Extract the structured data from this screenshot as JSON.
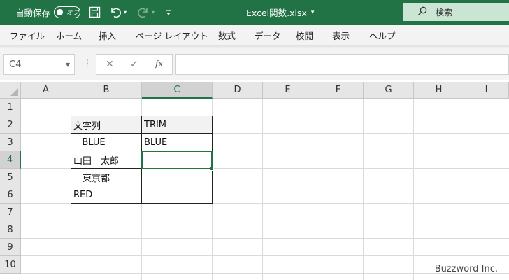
{
  "titlebar": {
    "autosave_label": "自動保存",
    "autosave_state": "オフ",
    "save_icon": "save-icon",
    "undo_icon": "undo-icon",
    "redo_icon": "redo-icon",
    "customize_icon": "customize-qat-icon",
    "file_title": "Excel関数.xlsx",
    "file_title_dropdown": "▾",
    "search_placeholder": "検索"
  },
  "ribbon": {
    "tabs": [
      "ファイル",
      "ホーム",
      "挿入",
      "ページ レイアウト",
      "数式",
      "データ",
      "校閲",
      "表示",
      "ヘルプ"
    ]
  },
  "formula_bar": {
    "name_box": "C4",
    "cancel_glyph": "✕",
    "enter_glyph": "✓",
    "fx_glyph": "fx",
    "formula": ""
  },
  "sheet": {
    "columns": [
      "A",
      "B",
      "C",
      "D",
      "E",
      "F",
      "G",
      "H",
      "I"
    ],
    "rows": [
      "1",
      "2",
      "3",
      "4",
      "5",
      "6",
      "7",
      "8",
      "9",
      "10"
    ],
    "selected_column": "C",
    "selected_row": "4",
    "cells": {
      "B2": "文字列",
      "C2": "TRIM",
      "B3": "   BLUE",
      "C3": "BLUE",
      "B4": "山田　太郎",
      "C4": "",
      "B5": "　東京都",
      "C5": "",
      "B6": "RED",
      "C6": ""
    }
  },
  "watermark": "Buzzword Inc.",
  "colors": {
    "accent": "#217346",
    "search_bg": "#cbe5d4",
    "ribbon_bg": "#f3f3f3"
  }
}
